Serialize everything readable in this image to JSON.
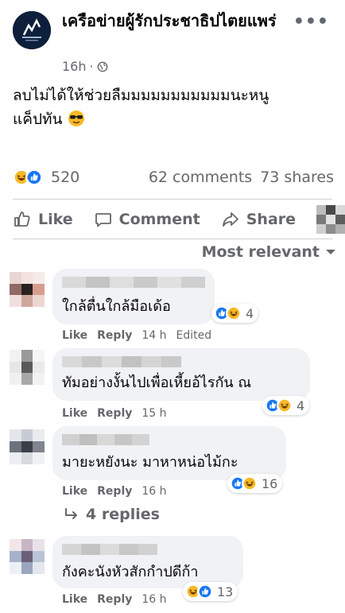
{
  "post": {
    "page_name": "เครือข่ายผู้รักประชาธิปไตยแพร่",
    "time": "16h",
    "separator": "·",
    "text_line1": "ลบไม่ได้ให้ช่วยลืมมมมมมมมมมมนะหนู",
    "text_line2": "แค็ปทัน"
  },
  "stats": {
    "reactions": "520",
    "comments": "62 comments",
    "shares": "73 shares"
  },
  "actions": {
    "like": "Like",
    "comment": "Comment",
    "share": "Share"
  },
  "sort": {
    "label": "Most relevant"
  },
  "comments": [
    {
      "text": "ใกล้ตื่นใกล้มือเด้อ",
      "like": "Like",
      "reply": "Reply",
      "time": "14 h",
      "edited": "Edited",
      "reaction_count": "4",
      "reactions": [
        "like-icon",
        "haha-icon"
      ]
    },
    {
      "text": "ทัมอย่างงั้นไปเพื่อเหี้ยอ้ไรกัน ณ",
      "like": "Like",
      "reply": "Reply",
      "time": "15 h",
      "reaction_count": "4",
      "reactions": [
        "like-icon",
        "haha-icon"
      ]
    },
    {
      "text": "มายะหยังนะ มาหาหน่อไม้กะ",
      "like": "Like",
      "reply": "Reply",
      "time": "16 h",
      "reaction_count": "16",
      "reactions": [
        "like-icon",
        "haha-icon"
      ],
      "replies": "4 replies"
    },
    {
      "text": "กังคะนังหัวสักกำปดีก้า",
      "like": "Like",
      "reply": "Reply",
      "time": "16 h",
      "reaction_count": "13",
      "reactions": [
        "haha-icon",
        "like-icon"
      ]
    }
  ],
  "colors": {
    "like_blue": "#1877f2",
    "haha_yellow": "#f7b928",
    "secondary_text": "#65676b",
    "bubble_bg": "#f0f2f5"
  }
}
